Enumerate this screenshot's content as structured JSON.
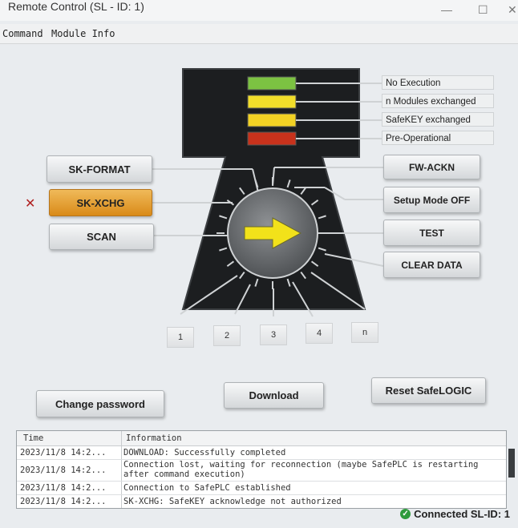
{
  "window": {
    "title": "Remote Control (SL - ID: 1)"
  },
  "menu": [
    "Command",
    "Module Info"
  ],
  "legend": [
    "No Execution",
    "n Modules exchanged",
    "SafeKEY exchanged",
    "Pre-Operational"
  ],
  "led_colors": [
    "#7cc242",
    "#f2de2a",
    "#f2d224",
    "#c8321c"
  ],
  "buttons": {
    "sk_format": "SK-FORMAT",
    "sk_xchg": "SK-XCHG",
    "scan": "SCAN",
    "fw_ackn": "FW-ACKN",
    "setup_mode_off": "Setup Mode OFF",
    "test": "TEST",
    "clear_data": "CLEAR DATA",
    "change_password": "Change password",
    "download": "Download",
    "reset_safelogic": "Reset SafeLOGIC"
  },
  "marker": "✕",
  "modules": [
    "1",
    "2",
    "3",
    "4",
    "n"
  ],
  "log": {
    "headers": [
      "Time",
      "Information"
    ],
    "rows": [
      {
        "time": "2023/11/8 14:2...",
        "info": "DOWNLOAD: Successfully completed"
      },
      {
        "time": "2023/11/8 14:2...",
        "info": "Connection lost, waiting for reconnection (maybe SafePLC is restarting",
        "info2": "after command execution)"
      },
      {
        "time": "2023/11/8 14:2...",
        "info": "Connection to SafePLC established"
      },
      {
        "time": "2023/11/8 14:2...",
        "info": "SK-XCHG: SafeKEY acknowledge not authorized"
      }
    ]
  },
  "status": "Connected SL-ID: 1",
  "status_color": "#2e9b3c"
}
